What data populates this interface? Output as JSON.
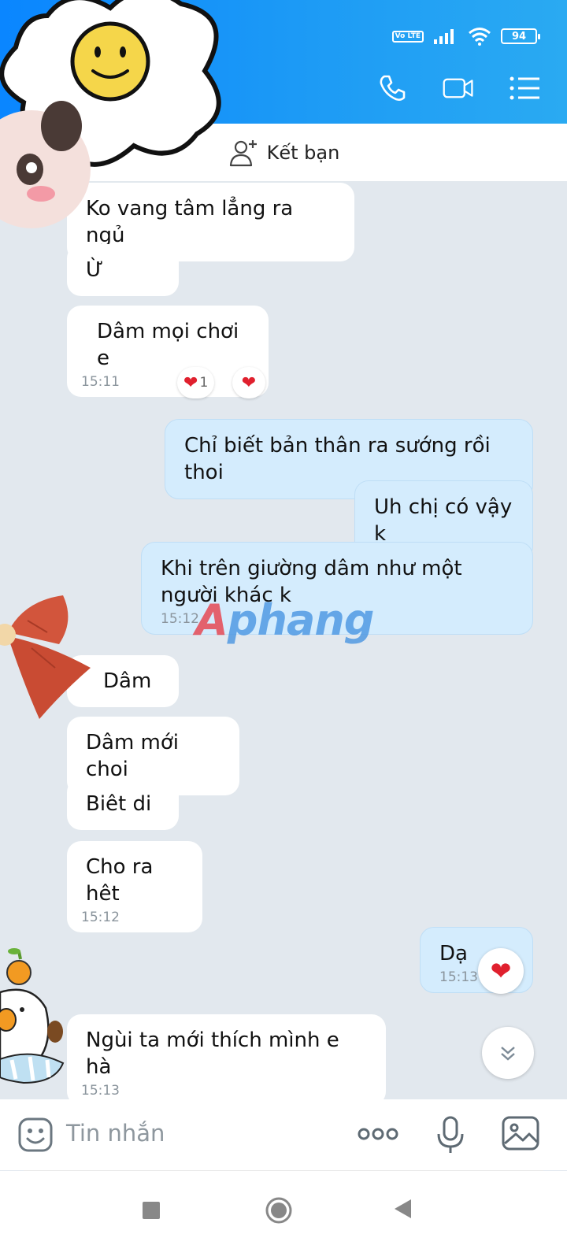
{
  "status_bar": {
    "network_badge": "Vo LTE",
    "battery": "94"
  },
  "header": {
    "icons": [
      "phone-icon",
      "video-call-icon",
      "menu-list-icon"
    ]
  },
  "add_friend": {
    "label": "Kết bạn"
  },
  "messages": [
    {
      "dir": "in",
      "text": "Ko vang tâm lẳng ra ngủ"
    },
    {
      "dir": "in",
      "text": "Ừ"
    },
    {
      "dir": "in",
      "text": "Dâm mọi chơi e",
      "time": "15:11",
      "reactions": [
        {
          "emoji": "❤",
          "count": "1"
        },
        {
          "emoji": "❤",
          "count": ""
        }
      ]
    },
    {
      "dir": "out",
      "text": "Chỉ biết bản thân ra sướng rồi thoi"
    },
    {
      "dir": "out",
      "text": "Uh chị có vậy k"
    },
    {
      "dir": "out",
      "text": "Khi trên giường dâm như một người khác k",
      "time": "15:12"
    },
    {
      "dir": "in",
      "text": "Dâm"
    },
    {
      "dir": "in",
      "text": "Dâm mới choi"
    },
    {
      "dir": "in",
      "text": "Biêt di"
    },
    {
      "dir": "in",
      "text": "Cho ra hêt",
      "time": "15:12"
    },
    {
      "dir": "out",
      "text": "Dạ",
      "time": "15:13",
      "reaction": "❤"
    },
    {
      "dir": "in",
      "text": "Ngùi ta mới thích  mình e hà",
      "time": "15:13"
    }
  ],
  "watermark": {
    "first": "A",
    "rest": "phang"
  },
  "input": {
    "placeholder": "Tin nhắn"
  },
  "colors": {
    "header": "#1d9bf5",
    "incoming_bubble": "#ffffff",
    "outgoing_bubble": "#d4ecfd",
    "chat_bg": "#e2e8ee",
    "heart": "#e0202e"
  }
}
